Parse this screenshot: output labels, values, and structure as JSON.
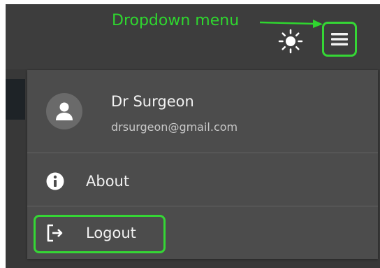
{
  "annotation": {
    "text": "Dropdown menu",
    "color": "#2fd62f"
  },
  "header": {
    "theme_toggle_icon": "sun-icon",
    "menu_icon": "hamburger-menu-icon",
    "highlight_color": "#35d635"
  },
  "dropdown": {
    "user": {
      "avatar_icon": "person-icon",
      "name": "Dr Surgeon",
      "email": "drsurgeon@gmail.com"
    },
    "items": [
      {
        "icon": "info-icon",
        "label": "About"
      },
      {
        "icon": "logout-icon",
        "label": "Logout"
      }
    ]
  }
}
